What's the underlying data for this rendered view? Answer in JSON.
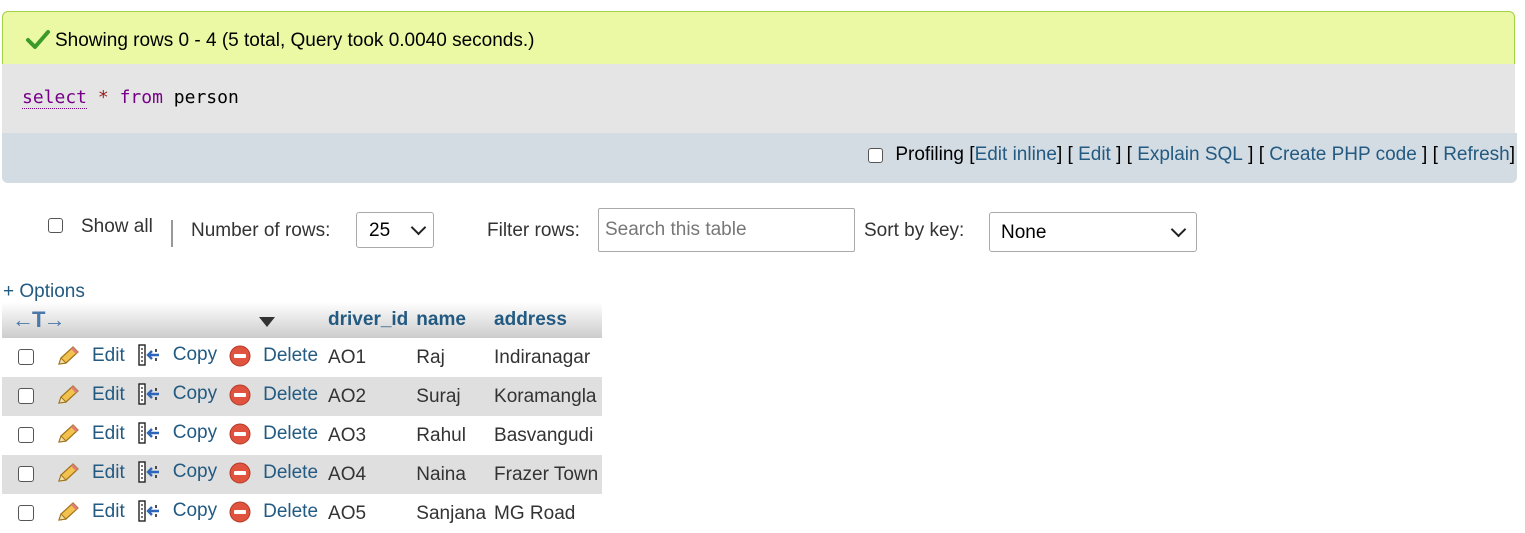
{
  "message": {
    "text": "Showing rows 0 - 4 (5 total, Query took 0.0040 seconds.)",
    "color": "#ebf8a4"
  },
  "sql": {
    "select": "select",
    "star": "*",
    "from": "from",
    "table": "person"
  },
  "tools": {
    "profiling_label": "Profiling",
    "links": {
      "edit_inline": "Edit inline",
      "edit": "Edit",
      "explain": "Explain SQL",
      "php": "Create PHP code",
      "refresh": "Refresh"
    }
  },
  "nav": {
    "show_all_label": "Show all",
    "rows_label": "Number of rows:",
    "rows_value": "25",
    "filter_label": "Filter rows:",
    "filter_placeholder": "Search this table",
    "sort_label": "Sort by key:",
    "sort_value": "None"
  },
  "options_label": "+ Options",
  "table": {
    "arrows": "←T→",
    "columns": [
      "driver_id",
      "name",
      "address"
    ],
    "actions": {
      "edit": "Edit",
      "copy": "Copy",
      "delete": "Delete"
    },
    "rows": [
      {
        "driver_id": "AO1",
        "name": "Raj",
        "address": "Indiranagar"
      },
      {
        "driver_id": "AO2",
        "name": "Suraj",
        "address": "Koramangla"
      },
      {
        "driver_id": "AO3",
        "name": "Rahul",
        "address": "Basvangudi"
      },
      {
        "driver_id": "AO4",
        "name": "Naina",
        "address": "Frazer Town"
      },
      {
        "driver_id": "AO5",
        "name": "Sanjana",
        "address": "MG Road"
      }
    ]
  },
  "colors": {
    "link": "#235a81",
    "success_bg": "#ebf8a4",
    "toolbar_bg": "#d3dce3",
    "sql_bg": "#e5e5e5"
  },
  "icons": [
    "check-icon",
    "pencil-icon",
    "copy-icon",
    "delete-icon",
    "sort-triangle-icon",
    "chevron-down-icon"
  ]
}
